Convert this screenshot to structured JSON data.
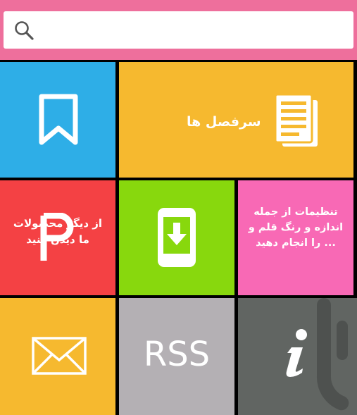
{
  "search": {
    "placeholder": ""
  },
  "tiles": {
    "chapters": {
      "label": "سرفصل ها"
    },
    "other": {
      "label": "از دیگر محصولات ما دیدن کنید"
    },
    "settings": {
      "label": "تنظیمات از جمله اندازه و رنگ قلم و ... را انجام دهید"
    },
    "rss": {
      "label": "RSS"
    }
  },
  "colors": {
    "header": "#ee6f9c",
    "bookmark": "#2eaee7",
    "chapters": "#f6b92f",
    "other": "#f44144",
    "download": "#88d80d",
    "settings": "#f869b5",
    "mail": "#f6b92f",
    "rss": "#b4b0b4",
    "info": "#616562"
  },
  "icons": {
    "search": "search-icon",
    "bookmark": "bookmark-icon",
    "chapters": "document-icon",
    "other": "p-logo-icon",
    "download": "phone-download-icon",
    "mail": "envelope-icon",
    "info": "info-icon",
    "watermark": "bazaar-logo-icon"
  }
}
